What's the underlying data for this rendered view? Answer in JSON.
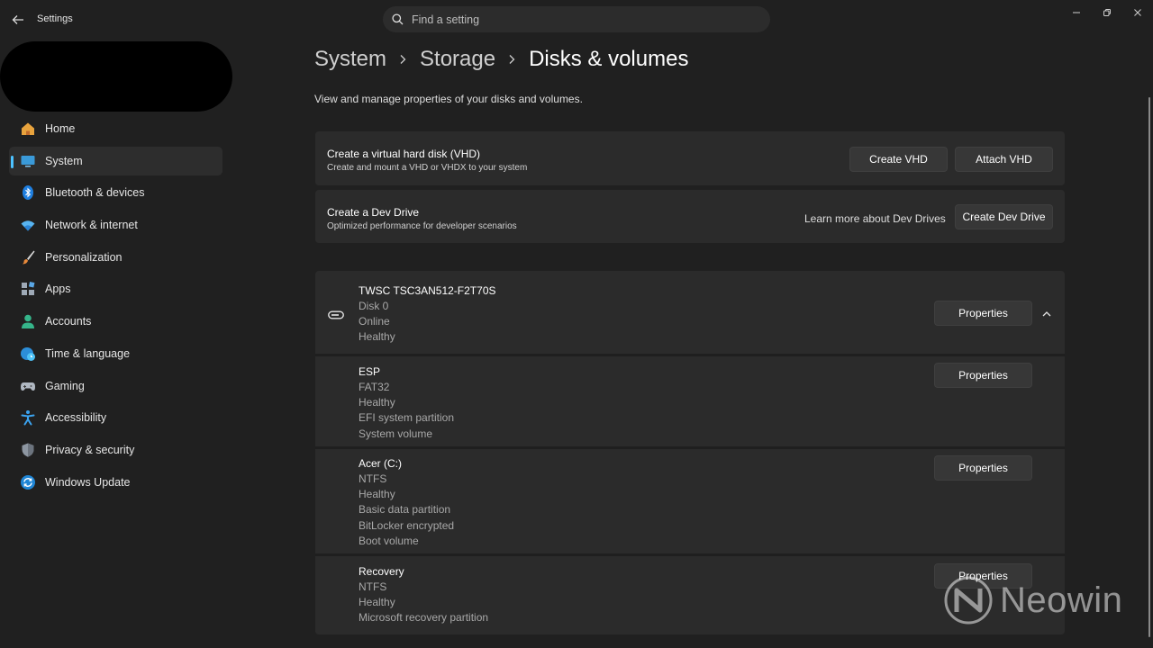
{
  "app": {
    "title": "Settings"
  },
  "search": {
    "placeholder": "Find a setting"
  },
  "sidebar": {
    "items": [
      {
        "label": "Home",
        "icon": "home-icon",
        "active": false
      },
      {
        "label": "System",
        "icon": "system-icon",
        "active": true
      },
      {
        "label": "Bluetooth & devices",
        "icon": "bluetooth-icon",
        "active": false
      },
      {
        "label": "Network & internet",
        "icon": "wifi-icon",
        "active": false
      },
      {
        "label": "Personalization",
        "icon": "brush-icon",
        "active": false
      },
      {
        "label": "Apps",
        "icon": "apps-icon",
        "active": false
      },
      {
        "label": "Accounts",
        "icon": "person-icon",
        "active": false
      },
      {
        "label": "Time & language",
        "icon": "globe-clock-icon",
        "active": false
      },
      {
        "label": "Gaming",
        "icon": "gamepad-icon",
        "active": false
      },
      {
        "label": "Accessibility",
        "icon": "accessibility-icon",
        "active": false
      },
      {
        "label": "Privacy & security",
        "icon": "shield-icon",
        "active": false
      },
      {
        "label": "Windows Update",
        "icon": "update-icon",
        "active": false
      }
    ]
  },
  "breadcrumb": {
    "items": [
      "System",
      "Storage",
      "Disks & volumes"
    ]
  },
  "page": {
    "description": "View and manage properties of your disks and volumes."
  },
  "vhd_card": {
    "title": "Create a virtual hard disk (VHD)",
    "subtitle": "Create and mount a VHD or VHDX to your system",
    "create_label": "Create VHD",
    "attach_label": "Attach VHD"
  },
  "dev_card": {
    "title": "Create a Dev Drive",
    "subtitle": "Optimized performance for developer scenarios",
    "link_label": "Learn more about Dev Drives",
    "create_label": "Create Dev Drive"
  },
  "disk": {
    "name": "TWSC TSC3AN512-F2T70S",
    "details": [
      "Disk 0",
      "Online",
      "Healthy"
    ],
    "properties_label": "Properties"
  },
  "volumes": [
    {
      "name": "ESP",
      "details": [
        "FAT32",
        "Healthy",
        "EFI system partition",
        "System volume"
      ],
      "properties_label": "Properties"
    },
    {
      "name": "Acer (C:)",
      "details": [
        "NTFS",
        "Healthy",
        "Basic data partition",
        "BitLocker encrypted",
        "Boot volume"
      ],
      "properties_label": "Properties"
    },
    {
      "name": "Recovery",
      "details": [
        "NTFS",
        "Healthy",
        "Microsoft recovery partition"
      ],
      "properties_label": "Properties"
    }
  ],
  "watermark": {
    "text": "Neowin"
  },
  "colors": {
    "accent": "#4cc2ff",
    "background": "#202020",
    "card": "#2b2b2b"
  }
}
